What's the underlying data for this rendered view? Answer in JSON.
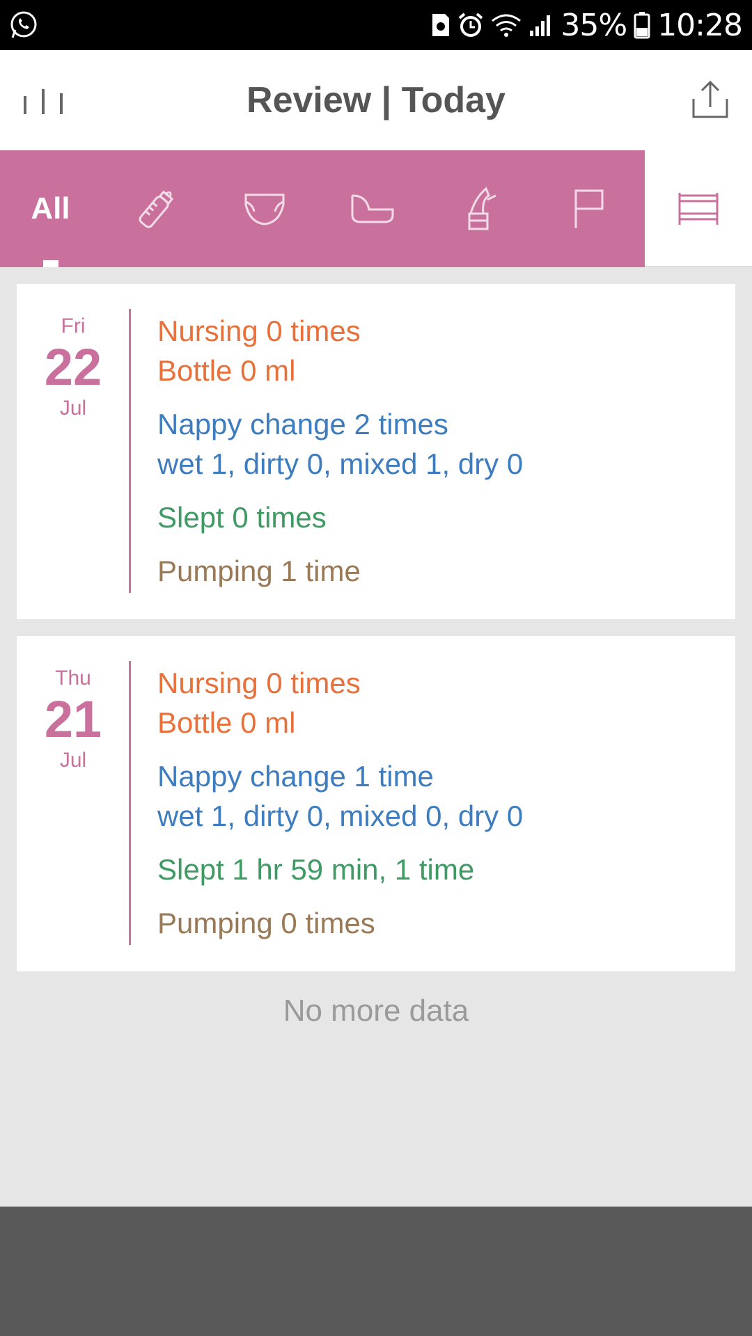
{
  "status_bar": {
    "battery_percent": "35%",
    "time": "10:28",
    "icons": [
      "whatsapp-icon",
      "sim-icon",
      "alarm-icon",
      "wifi-icon",
      "signal-icon",
      "battery-icon"
    ]
  },
  "app_bar": {
    "title": "Review | Today",
    "menu_icon": "bars-icon",
    "share_icon": "share-icon"
  },
  "tabs": {
    "all_label": "All",
    "selected": "All",
    "icons": [
      "bottle-icon",
      "diaper-icon",
      "bath-icon",
      "pump-icon",
      "flag-icon",
      "bed-icon"
    ],
    "colors": {
      "tab_background": "#c9719c",
      "active_text": "#ffffff"
    }
  },
  "days": [
    {
      "dow": "Fri",
      "day": "22",
      "month": "Jul",
      "nursing": "Nursing  0 times",
      "bottle": "Bottle 0 ml",
      "nappy": "Nappy change 2 times",
      "nappy_detail": "wet 1, dirty 0, mixed 1, dry 0",
      "slept": "Slept  0 times",
      "pumping": "Pumping 1 time"
    },
    {
      "dow": "Thu",
      "day": "21",
      "month": "Jul",
      "nursing": "Nursing  0 times",
      "bottle": "Bottle 0 ml",
      "nappy": "Nappy change 1 time",
      "nappy_detail": "wet 1, dirty 0, mixed 0, dry 0",
      "slept": "Slept 1 hr 59 min,  1 time",
      "pumping": "Pumping 0 times"
    }
  ],
  "footer_text": "No more data",
  "colors": {
    "feeding": "#e8703a",
    "nappy": "#3d7dbf",
    "sleep": "#3f9a63",
    "pumping": "#9a7a56",
    "accent": "#c9719c"
  }
}
